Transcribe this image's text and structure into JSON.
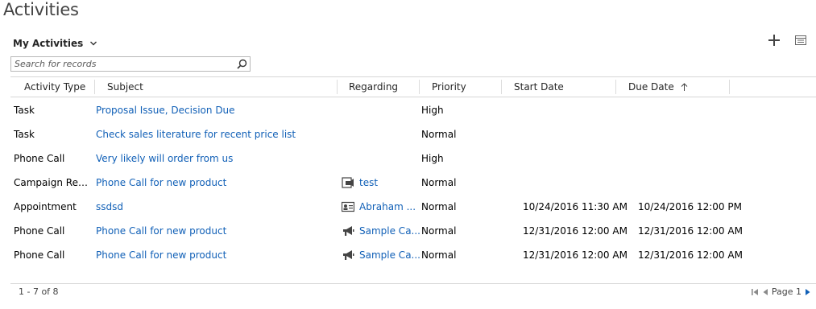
{
  "page": {
    "title": "Activities"
  },
  "view": {
    "label": "My Activities"
  },
  "toolbar": {
    "add_icon": "plus-icon",
    "grid_icon": "grid-view-icon"
  },
  "search": {
    "placeholder": "Search for records",
    "value": ""
  },
  "columns": {
    "activity_type": "Activity Type",
    "subject": "Subject",
    "regarding": "Regarding",
    "priority": "Priority",
    "start_date": "Start Date",
    "due_date": "Due Date",
    "sort": "ascending"
  },
  "rows": [
    {
      "activity_type": "Task",
      "subject": "Proposal Issue, Decision Due",
      "regarding": "",
      "regarding_icon": "",
      "priority": "High",
      "start_date": "",
      "due_date": ""
    },
    {
      "activity_type": "Task",
      "subject": "Check sales literature for recent price list",
      "regarding": "",
      "regarding_icon": "",
      "priority": "Normal",
      "start_date": "",
      "due_date": ""
    },
    {
      "activity_type": "Phone Call",
      "subject": "Very likely will order from us",
      "regarding": "",
      "regarding_icon": "",
      "priority": "High",
      "start_date": "",
      "due_date": ""
    },
    {
      "activity_type": "Campaign Resp...",
      "subject": "Phone Call for new product",
      "regarding": "test",
      "regarding_icon": "campaign-response-icon",
      "priority": "Normal",
      "start_date": "",
      "due_date": ""
    },
    {
      "activity_type": "Appointment",
      "subject": "ssdsd",
      "regarding": "Abraham ...",
      "regarding_icon": "contact-card-icon",
      "priority": "Normal",
      "start_date": "10/24/2016 11:30 AM",
      "due_date": "10/24/2016 12:00 PM"
    },
    {
      "activity_type": "Phone Call",
      "subject": "Phone Call for new product",
      "regarding": "Sample Ca...",
      "regarding_icon": "megaphone-icon",
      "priority": "Normal",
      "start_date": "12/31/2016 12:00 AM",
      "due_date": "12/31/2016 12:00 AM"
    },
    {
      "activity_type": "Phone Call",
      "subject": "Phone Call for new product",
      "regarding": "Sample Ca...",
      "regarding_icon": "megaphone-icon",
      "priority": "Normal",
      "start_date": "12/31/2016 12:00 AM",
      "due_date": "12/31/2016 12:00 AM"
    }
  ],
  "footer": {
    "record_count": "1 - 7 of 8",
    "page_label": "Page 1"
  },
  "colors": {
    "link": "#1160b7",
    "pager_active": "#1160b7",
    "pager_disabled": "#8a8a8a"
  }
}
